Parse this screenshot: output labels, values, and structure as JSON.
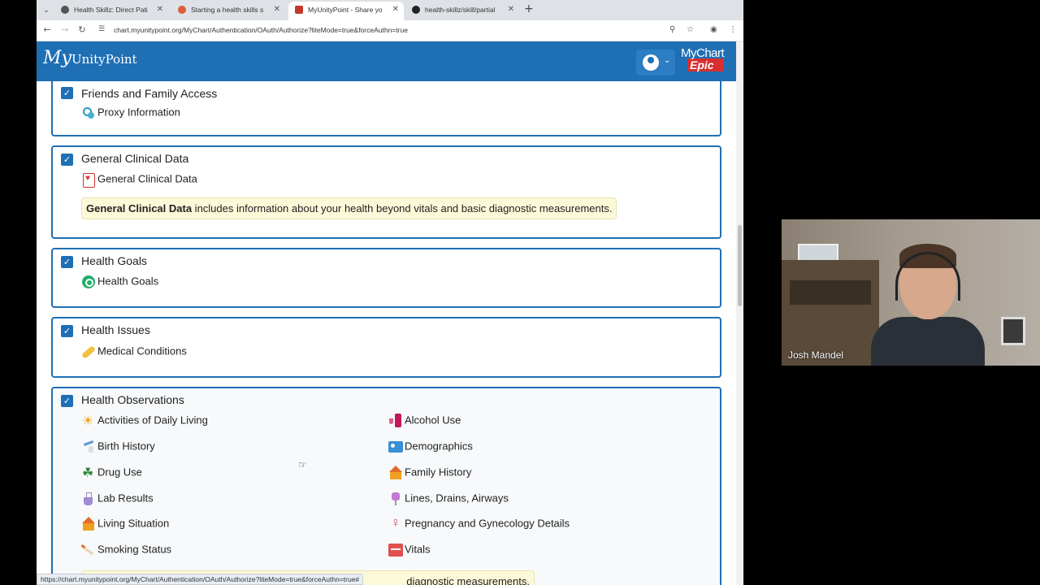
{
  "browser": {
    "tabs": [
      {
        "label": "Health Skillz: Direct Pati",
        "favicon_color": "#555555",
        "active": false
      },
      {
        "label": "Starting a health skills s",
        "favicon_color": "#d9603b",
        "active": false
      },
      {
        "label": "MyUnityPoint - Share yo",
        "favicon_color": "#c0392b",
        "active": true
      },
      {
        "label": "health-skillz/skill/partial",
        "favicon_color": "#222222",
        "active": false
      }
    ],
    "url": "chart.myunitypoint.org/MyChart/Authentication/OAuth/Authorize?liteMode=true&forceAuthn=true"
  },
  "header": {
    "logo_my": "My",
    "logo_rest": "UnityPoint",
    "brand_mychart": "MyChart",
    "brand_epic": "Epic",
    "accent": "#1f6fb5"
  },
  "cards": {
    "friends": {
      "title": "Friends and Family Access",
      "items": [
        {
          "label": "Proxy Information",
          "icon": "proxy-icon"
        }
      ]
    },
    "general": {
      "title": "General Clinical Data",
      "items": [
        {
          "label": "General Clinical Data",
          "icon": "clinical-card-icon"
        }
      ],
      "note_bold": "General Clinical Data",
      "note_rest": " includes information about your health beyond vitals and basic diagnostic measurements."
    },
    "goals": {
      "title": "Health Goals",
      "items": [
        {
          "label": "Health Goals",
          "icon": "target-icon"
        }
      ]
    },
    "issues": {
      "title": "Health Issues",
      "items": [
        {
          "label": "Medical Conditions",
          "icon": "bandaid-icon"
        }
      ]
    },
    "observations": {
      "title": "Health Observations",
      "left": [
        {
          "label": "Activities of Daily Living",
          "icon": "sun-icon"
        },
        {
          "label": "Birth History",
          "icon": "stork-icon"
        },
        {
          "label": "Drug Use",
          "icon": "leaf-icon"
        },
        {
          "label": "Lab Results",
          "icon": "flask-icon"
        },
        {
          "label": "Living Situation",
          "icon": "house-icon"
        },
        {
          "label": "Smoking Status",
          "icon": "cigarette-icon"
        }
      ],
      "right": [
        {
          "label": "Alcohol Use",
          "icon": "bottle-icon"
        },
        {
          "label": "Demographics",
          "icon": "id-card-icon"
        },
        {
          "label": "Family History",
          "icon": "house-icon"
        },
        {
          "label": "Lines, Drains, Airways",
          "icon": "iv-bag-icon"
        },
        {
          "label": "Pregnancy and Gynecology Details",
          "icon": "uterus-icon"
        },
        {
          "label": "Vitals",
          "icon": "vitals-icon"
        }
      ],
      "note_partial": "diagnostic measurements."
    }
  },
  "status_url": "https://chart.myunitypoint.org/MyChart/Authentication/OAuth/Authorize?liteMode=true&forceAuthn=true#",
  "webcam": {
    "name": "Josh Mandel"
  }
}
